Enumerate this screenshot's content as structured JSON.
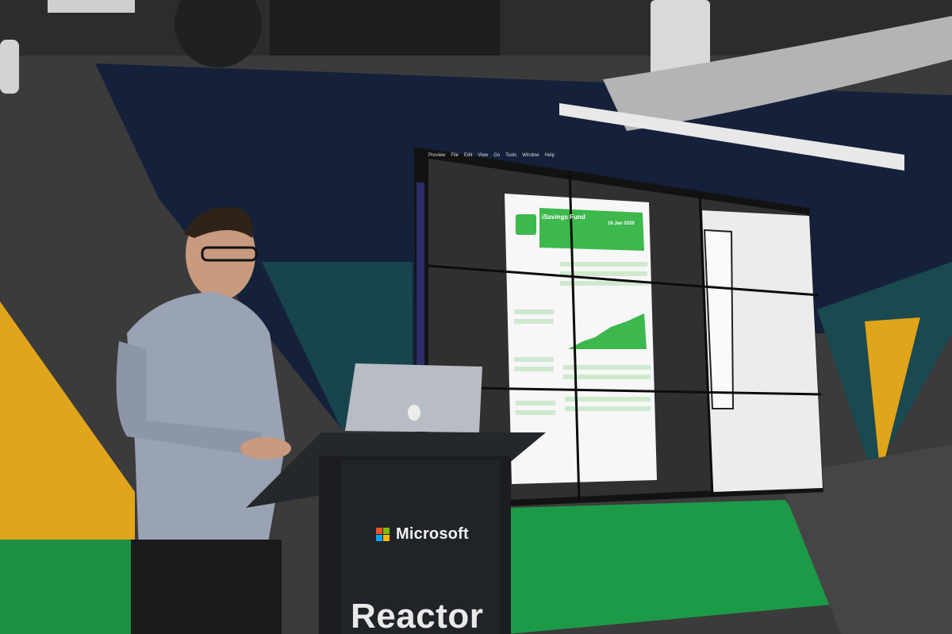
{
  "scene": {
    "description_colors": {
      "ceiling": "#2b2c2e",
      "wall_navy": "#15213a",
      "wall_teal": "#18454d",
      "wall_grey": "#3c3c3d",
      "wall_yellow": "#e0a51b",
      "wall_green": "#1d9a47",
      "screen_bg": "#f2f2f2",
      "doc_green": "#39b54a",
      "podium": "#1b1d20"
    }
  },
  "screen": {
    "menu": [
      "Preview",
      "File",
      "Edit",
      "View",
      "Go",
      "Tools",
      "Window",
      "Help"
    ],
    "doc_title": "iSavings Fund",
    "doc_date": "16 Jan 2020"
  },
  "podium": {
    "brand": "Microsoft",
    "logo_colors": [
      "#f25022",
      "#7fba00",
      "#00a4ef",
      "#ffb900"
    ],
    "sign": "Reactor"
  }
}
